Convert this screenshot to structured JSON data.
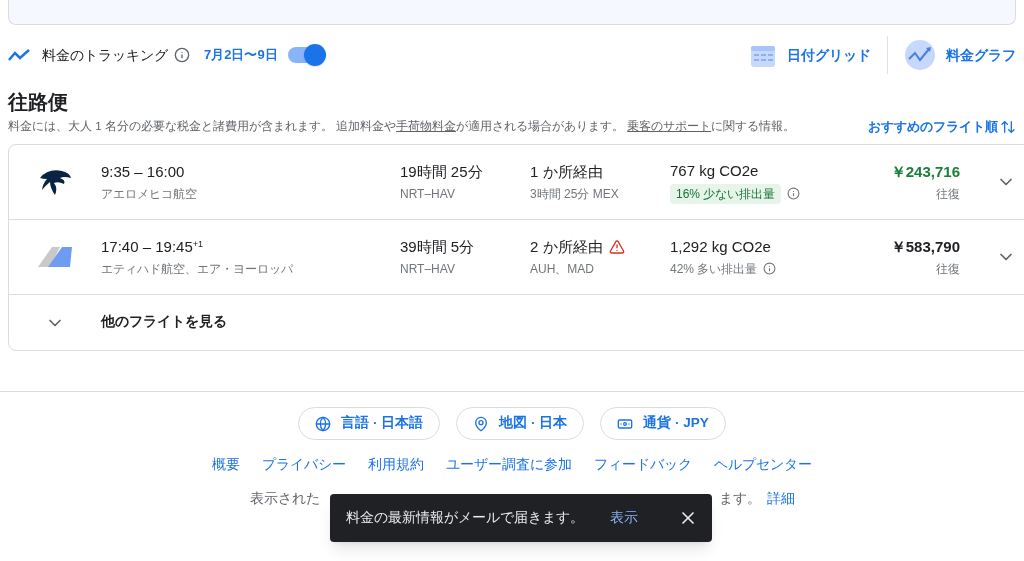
{
  "tracking": {
    "label": "料金のトラッキング",
    "dates": "7月2日〜9日",
    "on": true
  },
  "views": [
    {
      "label": "日付グリッド",
      "kind": "grid"
    },
    {
      "label": "料金グラフ",
      "kind": "graph"
    }
  ],
  "section": {
    "title": "往路便",
    "note_parts": [
      {
        "kind": "text",
        "text": "料金には、大人 1 名分の必要な税金と諸費用が含まれます。 追加料金や"
      },
      {
        "kind": "link",
        "text": "手荷物料金"
      },
      {
        "kind": "text",
        "text": "が適用される場合があります。 "
      },
      {
        "kind": "link",
        "text": "乗客のサポート"
      },
      {
        "kind": "text",
        "text": "に関する情報。"
      }
    ],
    "sort": "おすすめのフライト順"
  },
  "flights": [
    {
      "kind": "eagle",
      "times": "9:35 – 16:00",
      "airline": "アエロメヒコ航空",
      "duration": "19時間 25分",
      "route": "NRT–HAV",
      "stops": "1 か所経由",
      "warning": false,
      "layover": "3時間 25分 MEX",
      "co2": "767 kg CO2e",
      "emissions": "16% 少ない排出量",
      "low_emissions": true,
      "price": "￥243,716",
      "cheap": true,
      "trip": "往復"
    },
    {
      "kind": "tail",
      "times": "17:40 – 19:45",
      "day_offset": "+1",
      "airline": "エティハド航空、エア・ヨーロッパ",
      "duration": "39時間 5分",
      "route": "NRT–HAV",
      "stops": "2 か所経由",
      "warning": true,
      "layover": "AUH、MAD",
      "co2": "1,292 kg CO2e",
      "emissions": "42% 多い排出量",
      "low_emissions": false,
      "price": "￥583,790",
      "cheap": false,
      "trip": "往復"
    }
  ],
  "more_flights": "他のフライトを見る",
  "chips": [
    {
      "kind": "language",
      "label": "言語 · 日本語"
    },
    {
      "kind": "location",
      "label": "地図 · 日本"
    },
    {
      "kind": "currency",
      "label": "通貨 · JPY"
    }
  ],
  "footer_links": [
    "概要",
    "プライバシー",
    "利用規約",
    "ユーザー調査に参加",
    "フィードバック",
    "ヘルプセンター"
  ],
  "disclaimer": {
    "start": "表示された",
    "end": "ます。",
    "link": "詳細"
  },
  "toast": {
    "message": "料金の最新情報がメールで届きます。",
    "action": "表示"
  }
}
